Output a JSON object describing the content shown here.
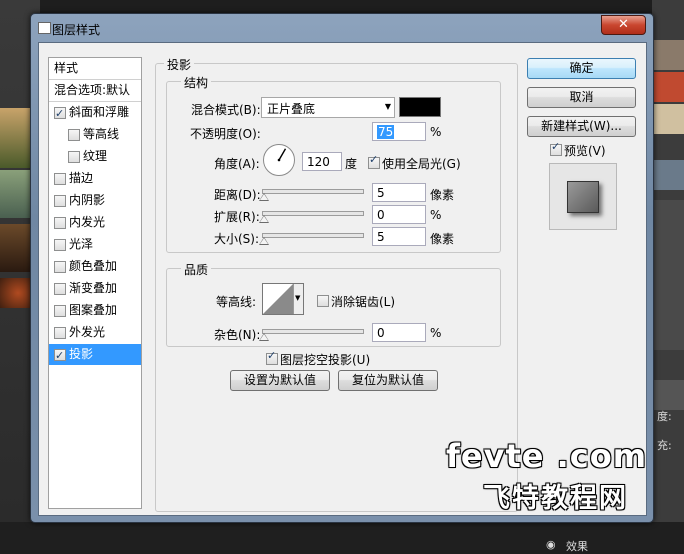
{
  "window": {
    "title": "图层样式",
    "close_glyph": "✕"
  },
  "styles_list": {
    "items": [
      {
        "label": "样式",
        "checkbox": false,
        "checked": false,
        "indent": 0,
        "selected": false
      },
      {
        "label": "混合选项:默认",
        "checkbox": false,
        "checked": false,
        "indent": 0,
        "selected": false
      },
      {
        "label": "斜面和浮雕",
        "checkbox": true,
        "checked": true,
        "indent": 0,
        "selected": false
      },
      {
        "label": "等高线",
        "checkbox": true,
        "checked": false,
        "indent": 1,
        "selected": false
      },
      {
        "label": "纹理",
        "checkbox": true,
        "checked": false,
        "indent": 1,
        "selected": false
      },
      {
        "label": "描边",
        "checkbox": true,
        "checked": false,
        "indent": 0,
        "selected": false
      },
      {
        "label": "内阴影",
        "checkbox": true,
        "checked": false,
        "indent": 0,
        "selected": false
      },
      {
        "label": "内发光",
        "checkbox": true,
        "checked": false,
        "indent": 0,
        "selected": false
      },
      {
        "label": "光泽",
        "checkbox": true,
        "checked": false,
        "indent": 0,
        "selected": false
      },
      {
        "label": "颜色叠加",
        "checkbox": true,
        "checked": false,
        "indent": 0,
        "selected": false
      },
      {
        "label": "渐变叠加",
        "checkbox": true,
        "checked": false,
        "indent": 0,
        "selected": false
      },
      {
        "label": "图案叠加",
        "checkbox": true,
        "checked": false,
        "indent": 0,
        "selected": false
      },
      {
        "label": "外发光",
        "checkbox": true,
        "checked": false,
        "indent": 0,
        "selected": false
      },
      {
        "label": "投影",
        "checkbox": true,
        "checked": true,
        "indent": 0,
        "selected": true
      }
    ]
  },
  "drop_shadow": {
    "group_title": "投影",
    "structure": {
      "title": "结构",
      "blend_mode_label": "混合模式(B):",
      "blend_mode_value": "正片叠底",
      "blend_color": "#000000",
      "opacity_label": "不透明度(O):",
      "opacity_value": "75",
      "opacity_unit": "%",
      "angle_label": "角度(A):",
      "angle_value": "120",
      "angle_unit": "度",
      "global_light_label": "使用全局光(G)",
      "global_light_checked": true,
      "distance_label": "距离(D):",
      "distance_value": "5",
      "distance_unit": "像素",
      "spread_label": "扩展(R):",
      "spread_value": "0",
      "spread_unit": "%",
      "size_label": "大小(S):",
      "size_value": "5",
      "size_unit": "像素"
    },
    "quality": {
      "title": "品质",
      "contour_label": "等高线:",
      "anti_alias_label": "消除锯齿(L)",
      "anti_alias_checked": false,
      "noise_label": "杂色(N):",
      "noise_value": "0",
      "noise_unit": "%"
    },
    "knockout_label": "图层挖空投影(U)",
    "knockout_checked": true,
    "make_default_label": "设置为默认值",
    "reset_default_label": "复位为默认值"
  },
  "side_buttons": {
    "ok": "确定",
    "cancel": "取消",
    "new_style": "新建样式(W)...",
    "preview_label": "预览(V)",
    "preview_checked": true
  },
  "watermark": {
    "line1": "fevte .com",
    "line2": "飞特教程网"
  },
  "background": {
    "effects_label": "效果",
    "label_a": "度:",
    "label_b": "充:"
  }
}
